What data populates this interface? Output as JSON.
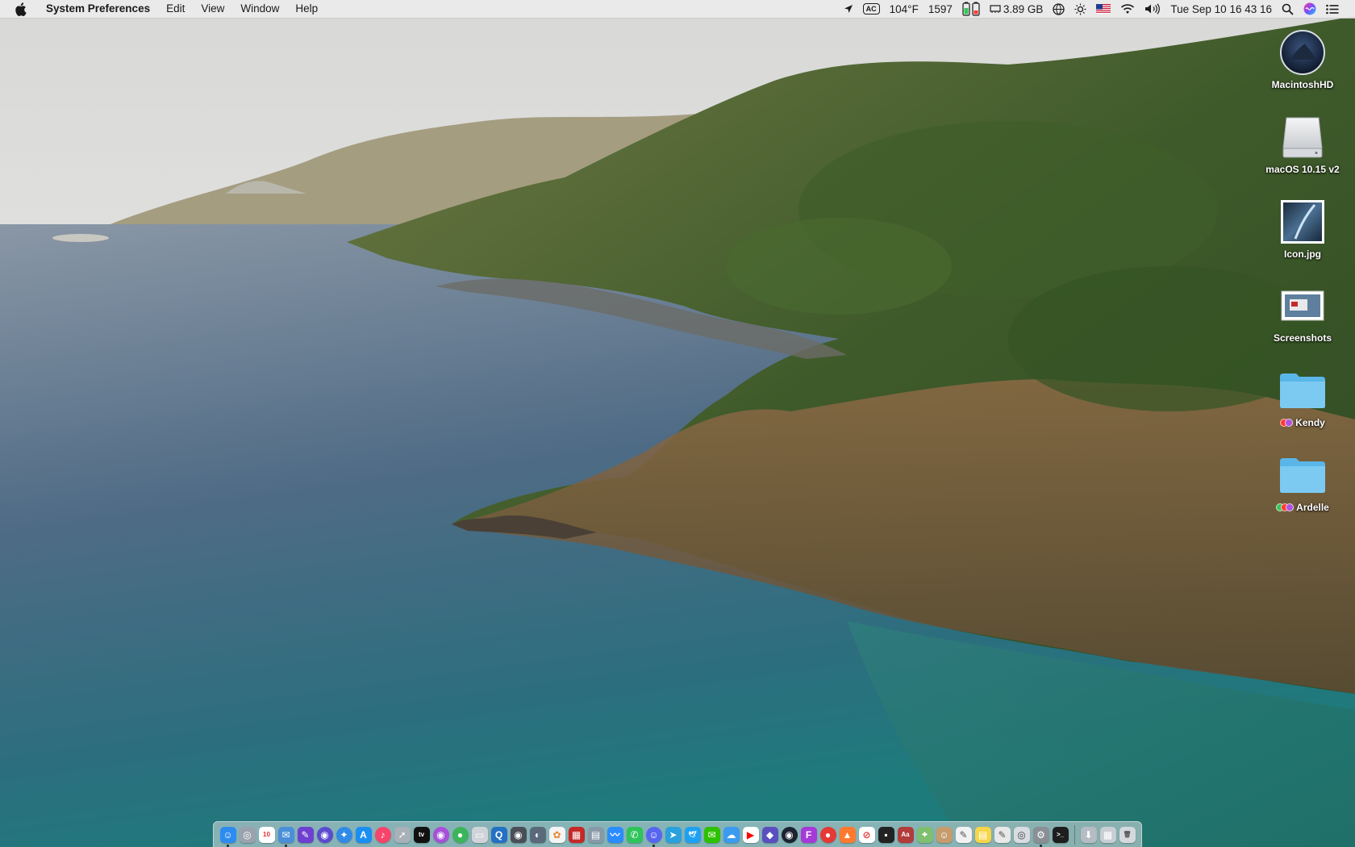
{
  "menubar": {
    "apple_icon": "apple-logo-icon",
    "app_name": "System Preferences",
    "menus": [
      "Edit",
      "View",
      "Window",
      "Help"
    ],
    "status": {
      "temperature": "104°F",
      "fan_rpm": "1597",
      "ac_label": "AC",
      "memory": "3.89 GB",
      "clock": "Tue Sep 10  16 43 16"
    }
  },
  "desktop": {
    "icons": [
      {
        "label": "MacintoshHD",
        "type": "disk-icon"
      },
      {
        "label": "macOS 10.15 v2",
        "type": "drive-icon"
      },
      {
        "label": "Icon.jpg",
        "type": "image-file-icon"
      },
      {
        "label": "Screenshots",
        "type": "screenshot-folder-icon"
      },
      {
        "label": "Kendy",
        "type": "folder-icon",
        "tags": [
          "#ff3b30",
          "#af52de"
        ]
      },
      {
        "label": "Ardelle",
        "type": "folder-icon",
        "tags": [
          "#34c759",
          "#ff3b30",
          "#af52de"
        ]
      }
    ]
  },
  "dock": {
    "apps": [
      {
        "name": "finder",
        "color": "#2d8cf0",
        "glyph": "☺",
        "running": true
      },
      {
        "name": "launchpad",
        "color": "#9aa3ad",
        "glyph": "◎"
      },
      {
        "name": "calendar",
        "color": "#ffffff",
        "glyph": "10",
        "glyph_color": "#e0332f"
      },
      {
        "name": "mail",
        "color": "#4a8fd8",
        "glyph": "✉",
        "running": true
      },
      {
        "name": "notes",
        "color": "#6e3fd0",
        "glyph": "✎"
      },
      {
        "name": "siri",
        "color": "#5b4bcf",
        "glyph": "◉"
      },
      {
        "name": "safari",
        "color": "#2f8be6",
        "glyph": "✦"
      },
      {
        "name": "app-store",
        "color": "#1b8ef2",
        "glyph": "A"
      },
      {
        "name": "music",
        "color": "#f8446a",
        "glyph": "♪"
      },
      {
        "name": "rocket",
        "color": "#a8b0b8",
        "glyph": "➚"
      },
      {
        "name": "tv",
        "color": "#111111",
        "glyph": "tv"
      },
      {
        "name": "podcasts",
        "color": "#a750d8",
        "glyph": "◉"
      },
      {
        "name": "find-my",
        "color": "#3cb55a",
        "glyph": "●"
      },
      {
        "name": "preview",
        "color": "#d0d4d8",
        "glyph": "▭"
      },
      {
        "name": "quicktime",
        "color": "#2470c4",
        "glyph": "Q"
      },
      {
        "name": "camera",
        "color": "#4a4f57",
        "glyph": "◉"
      },
      {
        "name": "photo-booth",
        "color": "#5b6a7a",
        "glyph": "◐"
      },
      {
        "name": "photos",
        "color": "#f4f4f4",
        "glyph": "✿",
        "glyph_color": "#e7832b"
      },
      {
        "name": "photo-booth-red",
        "color": "#c62828",
        "glyph": "▦"
      },
      {
        "name": "image-capture",
        "color": "#889aa8",
        "glyph": "▤"
      },
      {
        "name": "messenger",
        "color": "#2a8cff",
        "glyph": "〰"
      },
      {
        "name": "whatsapp",
        "color": "#2ec45a",
        "glyph": "✆"
      },
      {
        "name": "discord",
        "color": "#5865f2",
        "glyph": "☺",
        "running": true
      },
      {
        "name": "telegram",
        "color": "#2aa1de",
        "glyph": "➤"
      },
      {
        "name": "twitter",
        "color": "#1da1f2",
        "glyph": "🕊"
      },
      {
        "name": "wechat",
        "color": "#2dc100",
        "glyph": "✉"
      },
      {
        "name": "weather",
        "color": "#3a9bef",
        "glyph": "☁"
      },
      {
        "name": "youtube",
        "color": "#ffffff",
        "glyph": "▶",
        "glyph_color": "#ff0000"
      },
      {
        "name": "vpn",
        "color": "#5a4fc0",
        "glyph": "◆"
      },
      {
        "name": "camo",
        "color": "#1c2230",
        "glyph": "◉"
      },
      {
        "name": "figma",
        "color": "#a63ad9",
        "glyph": "F"
      },
      {
        "name": "recorder",
        "color": "#e53935",
        "glyph": "●"
      },
      {
        "name": "music-red",
        "color": "#ff7a2f",
        "glyph": "▲"
      },
      {
        "name": "block",
        "color": "#ffffff",
        "glyph": "⊘",
        "glyph_color": "#e53935"
      },
      {
        "name": "console",
        "color": "#222222",
        "glyph": "▪"
      },
      {
        "name": "dictionary",
        "color": "#b23b3b",
        "glyph": "Aa"
      },
      {
        "name": "maps",
        "color": "#7fbf6f",
        "glyph": "⌖"
      },
      {
        "name": "contacts",
        "color": "#c69c6d",
        "glyph": "☺"
      },
      {
        "name": "text-edit",
        "color": "#f2f2f2",
        "glyph": "✎",
        "glyph_color": "#555"
      },
      {
        "name": "stickies",
        "color": "#f7d64a",
        "glyph": "▤"
      },
      {
        "name": "script-editor",
        "color": "#e8e8e8",
        "glyph": "✎",
        "glyph_color": "#555"
      },
      {
        "name": "disk-utility",
        "color": "#d8dde2",
        "glyph": "◎",
        "glyph_color": "#444"
      },
      {
        "name": "system-preferences",
        "color": "#8a8f96",
        "glyph": "⚙",
        "running": true
      },
      {
        "name": "terminal",
        "color": "#1e1e1e",
        "glyph": ">_"
      },
      {
        "name": "downloads",
        "color": "#b6bcc3",
        "glyph": "⬇"
      },
      {
        "name": "documents",
        "color": "#c9ced4",
        "glyph": "▦"
      },
      {
        "name": "trash",
        "color": "#d5d9de",
        "glyph": "🗑",
        "glyph_color": "#555"
      }
    ]
  }
}
